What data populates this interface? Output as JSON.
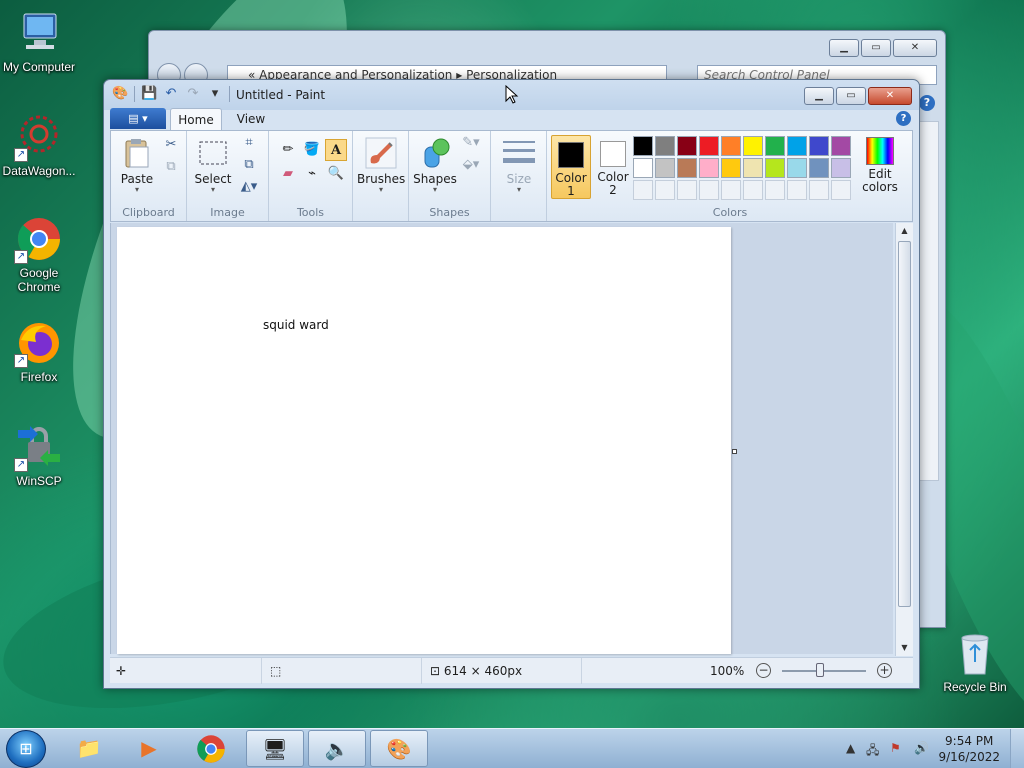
{
  "desktop": {
    "icons": [
      {
        "label": "My Computer",
        "icon": "computer-icon"
      },
      {
        "label": "DataWagon...",
        "icon": "datawagon-icon"
      },
      {
        "label": "Google Chrome",
        "icon": "chrome-icon"
      },
      {
        "label": "Firefox",
        "icon": "firefox-icon"
      },
      {
        "label": "WinSCP",
        "icon": "winscp-icon"
      },
      {
        "label": "Recycle Bin",
        "icon": "recycle-bin-icon"
      }
    ]
  },
  "control_panel": {
    "breadcrumb_1": "« Appearance and Personalization",
    "breadcrumb_sep": "▸",
    "breadcrumb_2": "Personalization",
    "search_placeholder": "Search Control Panel"
  },
  "paint": {
    "title": "Untitled - Paint",
    "tabs": {
      "file": "▤ ▾",
      "home": "Home",
      "view": "View"
    },
    "clipboard": {
      "paste": "Paste",
      "label": "Clipboard"
    },
    "image": {
      "select": "Select",
      "label": "Image"
    },
    "tools": {
      "label": "Tools"
    },
    "brushes": {
      "label": "Brushes"
    },
    "shapes": {
      "button": "Shapes",
      "label": "Shapes"
    },
    "size": {
      "label": "Size"
    },
    "colors": {
      "color1_line1": "Color",
      "color1_line2": "1",
      "color2_line1": "Color",
      "color2_line2": "2",
      "edit_line1": "Edit",
      "edit_line2": "colors",
      "label": "Colors",
      "color1_value": "#000000",
      "color2_value": "#ffffff",
      "palette": [
        "#000000",
        "#7f7f7f",
        "#880015",
        "#ed1c24",
        "#ff7f27",
        "#fff200",
        "#22b14c",
        "#00a2e8",
        "#3f48cc",
        "#a349a4",
        "#ffffff",
        "#c3c3c3",
        "#b97a57",
        "#ffaec9",
        "#ffc90e",
        "#efe4b0",
        "#b5e61d",
        "#99d9ea",
        "#7092be",
        "#c8bfe7",
        "",
        "",
        "",
        "",
        "",
        "",
        "",
        "",
        "",
        ""
      ]
    },
    "canvas_text": "squid ward",
    "status": {
      "canvas_size": "614 × 460px",
      "zoom": "100%"
    }
  },
  "taskbar": {
    "time": "9:54 PM",
    "date": "9/16/2022"
  }
}
